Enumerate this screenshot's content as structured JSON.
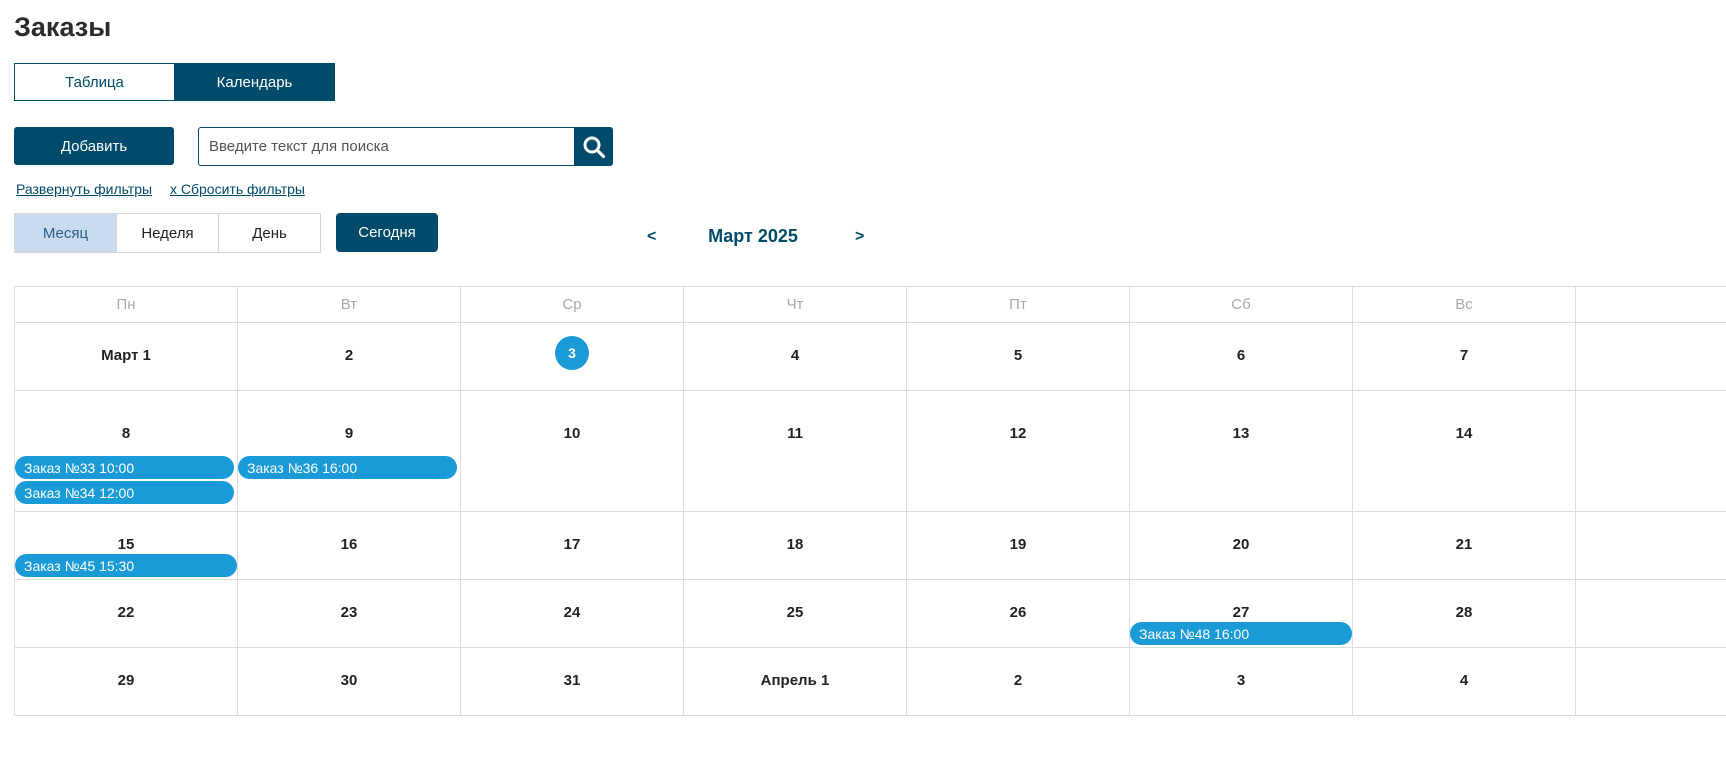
{
  "page": {
    "title": "Заказы"
  },
  "view_tabs": {
    "table": "Таблица",
    "calendar": "Календарь"
  },
  "toolbar": {
    "add_label": "Добавить"
  },
  "search": {
    "placeholder": "Введите текст для поиска",
    "value": ""
  },
  "filters": {
    "expand_label": "Развернуть фильтры",
    "reset_label": "x Сбросить фильтры"
  },
  "calendar": {
    "range_buttons": {
      "month": "Месяц",
      "week": "Неделя",
      "day": "День"
    },
    "today_label": "Сегодня",
    "prev_label": "<",
    "next_label": ">",
    "current_period": "Март 2025",
    "weekdays": [
      "Пн",
      "Вт",
      "Ср",
      "Чт",
      "Пт",
      "Сб",
      "Вс"
    ],
    "weeks": [
      {
        "days": [
          "Март 1",
          "2",
          "3",
          "4",
          "5",
          "6",
          "7"
        ]
      },
      {
        "days": [
          "8",
          "9",
          "10",
          "11",
          "12",
          "13",
          "14"
        ]
      },
      {
        "days": [
          "15",
          "16",
          "17",
          "18",
          "19",
          "20",
          "21"
        ]
      },
      {
        "days": [
          "22",
          "23",
          "24",
          "25",
          "26",
          "27",
          "28"
        ]
      },
      {
        "days": [
          "29",
          "30",
          "31",
          "Апрель 1",
          "2",
          "3",
          "4"
        ]
      }
    ],
    "today_day": "3",
    "events": [
      {
        "label": "Заказ №33 10:00"
      },
      {
        "label": "Заказ №34 12:00"
      },
      {
        "label": "Заказ №36 16:00"
      },
      {
        "label": "Заказ №45 15:30"
      },
      {
        "label": "Заказ №48 16:00"
      }
    ]
  },
  "colors": {
    "primary": "#004a6b",
    "event": "#1a9bd7",
    "today_highlight": "#1a9bd7",
    "range_active_bg": "#c9dcef",
    "grid_line": "#dddddd",
    "weekday_text": "#a9a9a9"
  },
  "icons": {
    "search": "search-icon"
  }
}
